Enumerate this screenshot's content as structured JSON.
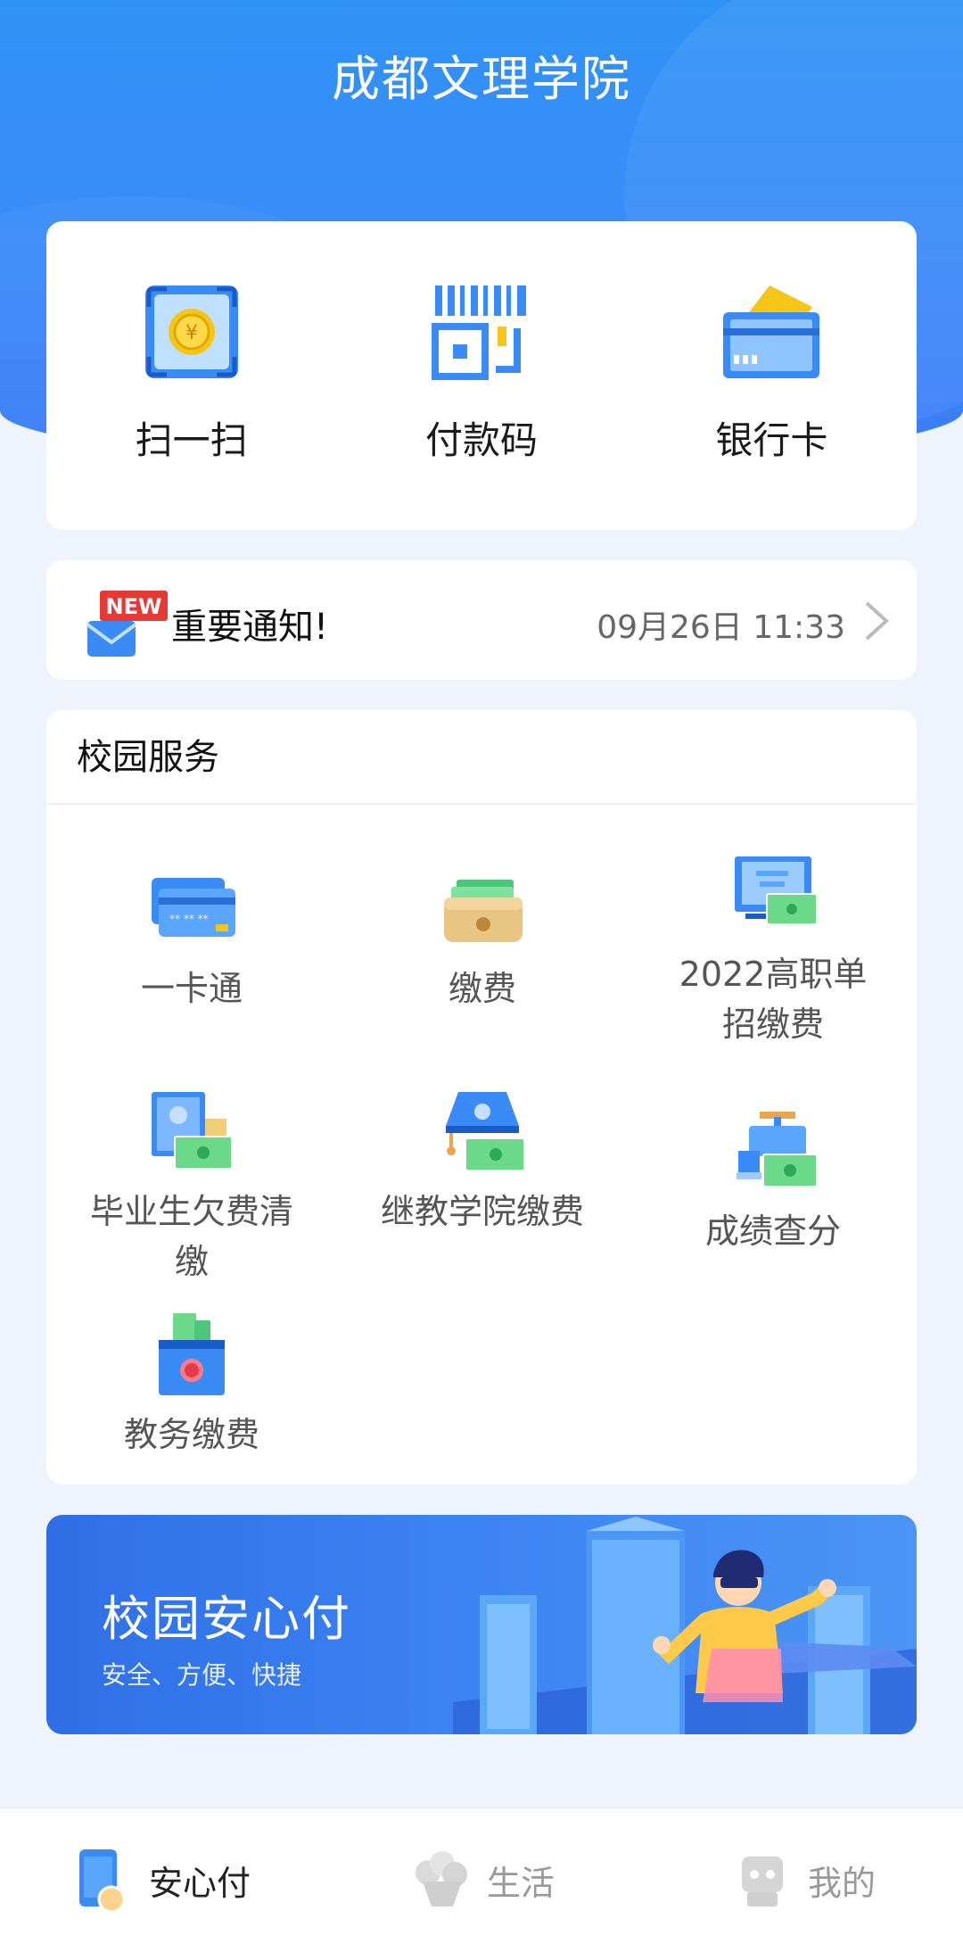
{
  "app": {
    "title": "成都文理学院"
  },
  "quick_actions": [
    {
      "label": "扫一扫",
      "icon": "scan-icon"
    },
    {
      "label": "付款码",
      "icon": "payment-code-icon"
    },
    {
      "label": "银行卡",
      "icon": "bank-card-icon"
    }
  ],
  "notice": {
    "badge": "NEW",
    "title": "重要通知!",
    "time": "09月26日 11:33"
  },
  "services": {
    "heading": "校园服务",
    "items": [
      {
        "label": "一卡通",
        "icon": "campus-card-icon"
      },
      {
        "label": "缴费",
        "icon": "wallet-icon"
      },
      {
        "label": "2022高职单招缴费",
        "icon": "monitor-payment-icon"
      },
      {
        "label": "毕业生欠费清缴",
        "icon": "graduate-payment-icon"
      },
      {
        "label": "继教学院缴费",
        "icon": "lamp-payment-icon"
      },
      {
        "label": "成绩查分",
        "icon": "faucet-payment-icon"
      },
      {
        "label": "教务缴费",
        "icon": "box-payment-icon"
      }
    ]
  },
  "banner": {
    "title": "校园安心付",
    "subtitle": "安全、方便、快捷"
  },
  "tabbar": [
    {
      "label": "安心付",
      "icon": "phone-pay-icon",
      "active": true
    },
    {
      "label": "生活",
      "icon": "life-icon",
      "active": false
    },
    {
      "label": "我的",
      "icon": "profile-icon",
      "active": false
    }
  ],
  "colors": {
    "brand": "#3B8BF7",
    "page_background": "#EEF3FC",
    "badge_red": "#E53935",
    "coin_yellow": "#F5C518",
    "money_green": "#6BD88A"
  }
}
